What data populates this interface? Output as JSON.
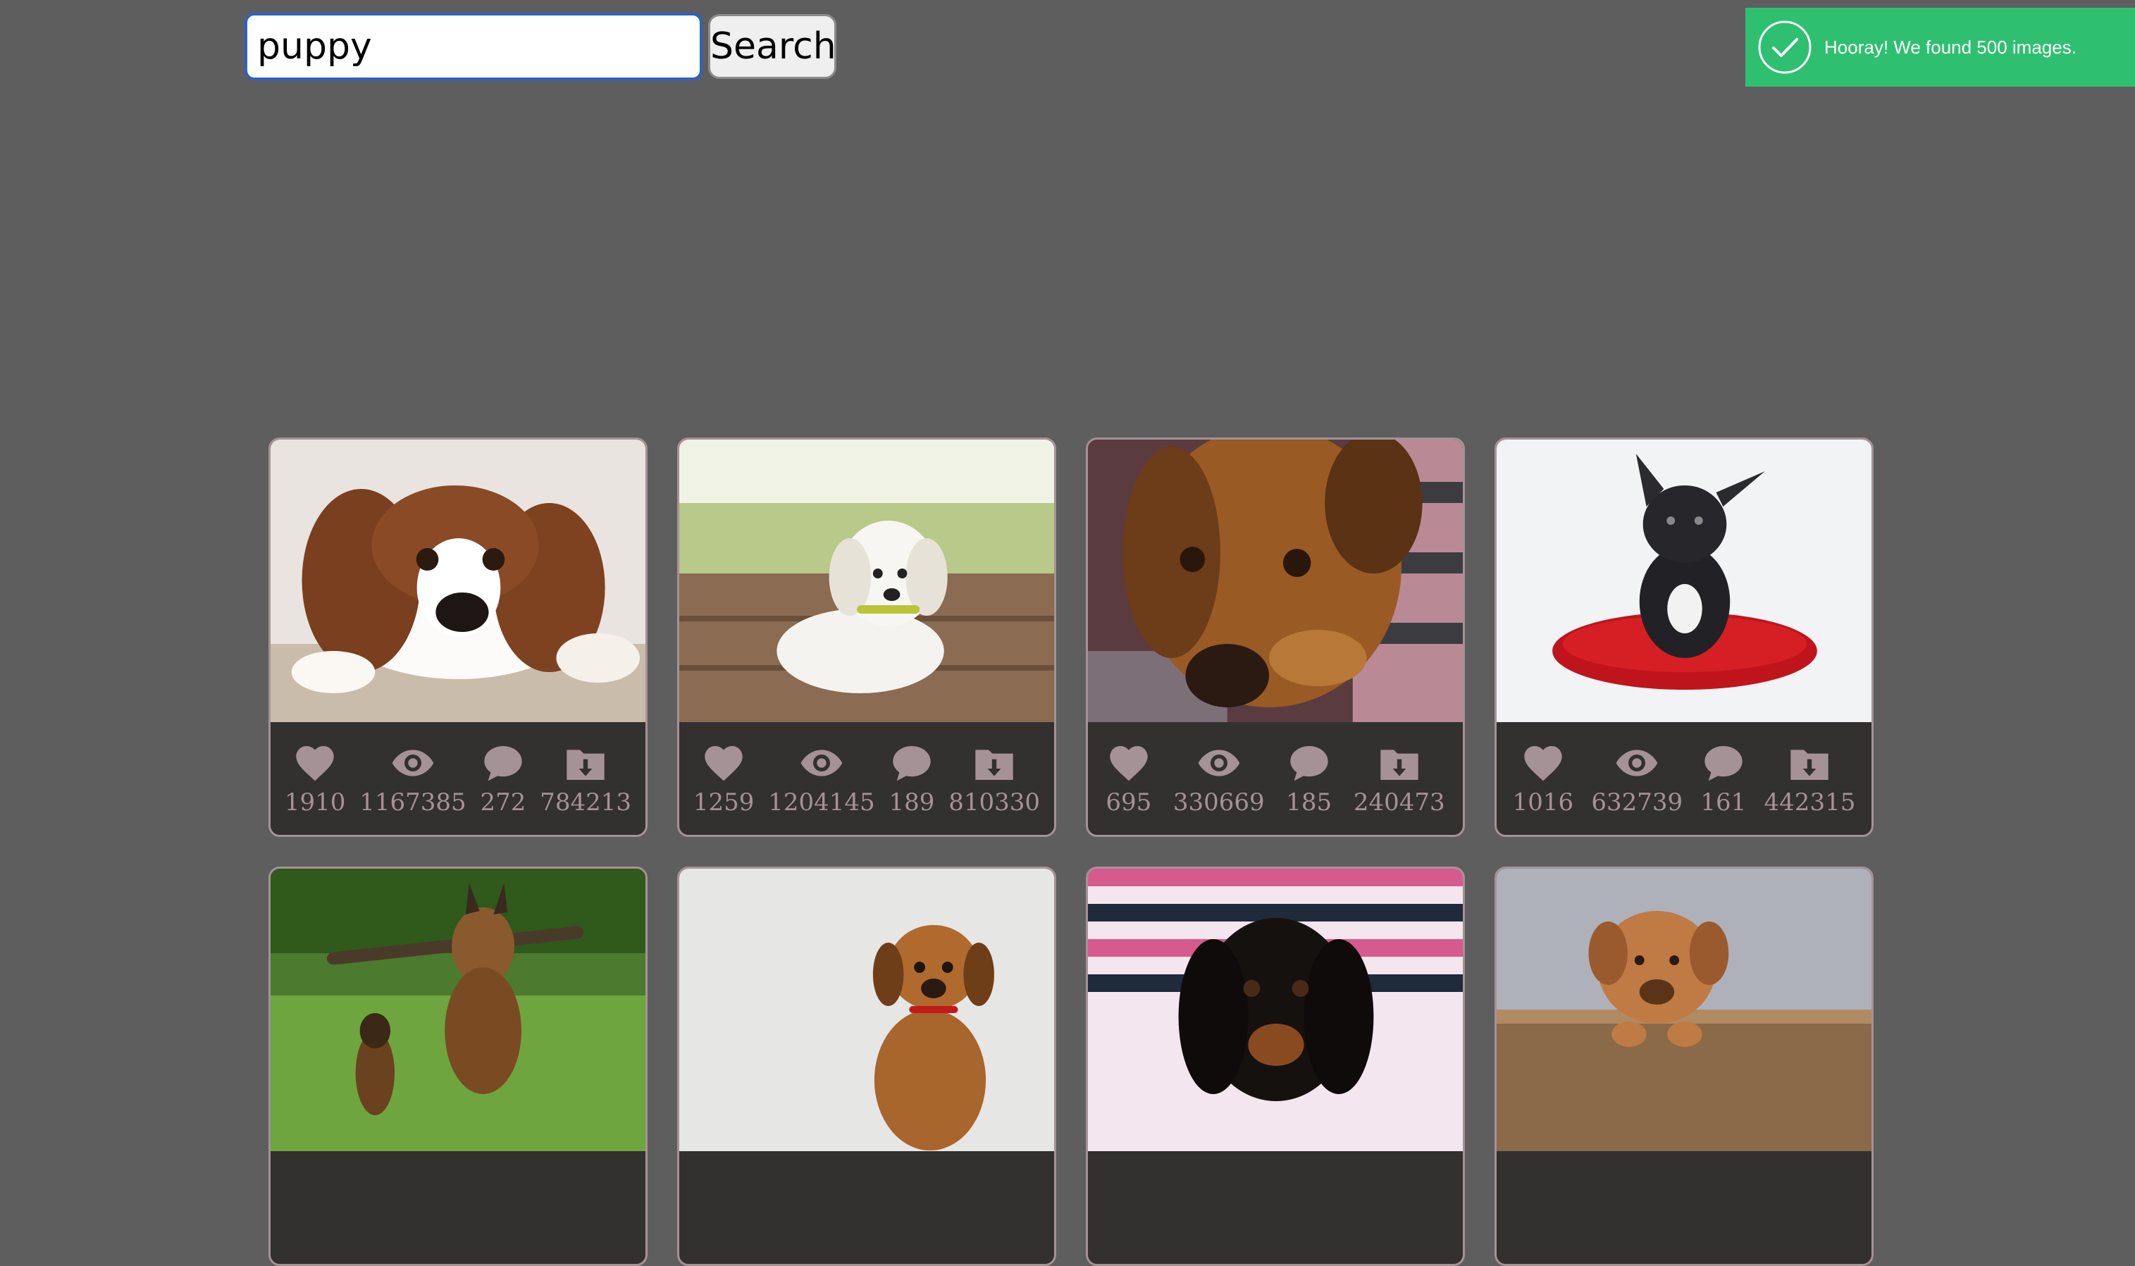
{
  "search": {
    "value": "puppy",
    "button_label": "Search"
  },
  "toast": {
    "message": "Hooray! We found 500 images.",
    "icon": "check-circle-icon",
    "color": "#2fbf71"
  },
  "colors": {
    "background": "#5e5e5e",
    "card_border": "#a59296",
    "stats_bar": "#333030",
    "stats_text": "#a59296"
  },
  "stat_icons": [
    "heart-icon",
    "eye-icon",
    "comment-icon",
    "download-icon"
  ],
  "cards": [
    {
      "likes": "1910",
      "views": "1167385",
      "comments": "272",
      "downloads": "784213"
    },
    {
      "likes": "1259",
      "views": "1204145",
      "comments": "189",
      "downloads": "810330"
    },
    {
      "likes": "695",
      "views": "330669",
      "comments": "185",
      "downloads": "240473"
    },
    {
      "likes": "1016",
      "views": "632739",
      "comments": "161",
      "downloads": "442315"
    },
    {
      "likes": "",
      "views": "",
      "comments": "",
      "downloads": ""
    },
    {
      "likes": "",
      "views": "",
      "comments": "",
      "downloads": ""
    },
    {
      "likes": "",
      "views": "",
      "comments": "",
      "downloads": ""
    },
    {
      "likes": "",
      "views": "",
      "comments": "",
      "downloads": ""
    }
  ]
}
